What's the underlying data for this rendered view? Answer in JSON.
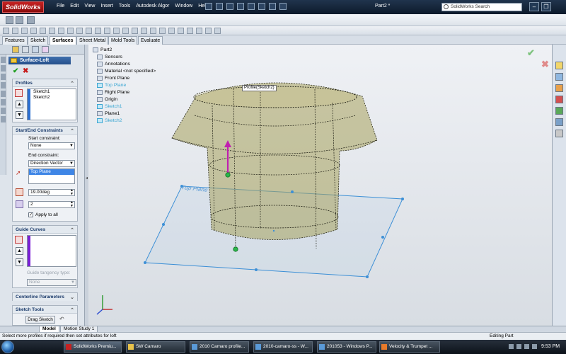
{
  "app": {
    "name": "SolidWorks",
    "document_title": "Part2 *"
  },
  "menu": [
    "File",
    "Edit",
    "View",
    "Insert",
    "Tools",
    "Autodesk Algor",
    "Window",
    "Help"
  ],
  "search": {
    "placeholder": "SolidWorks Search"
  },
  "command_tabs": [
    "Features",
    "Sketch",
    "Surfaces",
    "Sheet Metal",
    "Mold Tools",
    "Evaluate"
  ],
  "property_manager": {
    "title": "Surface-Loft",
    "profiles": {
      "title": "Profiles",
      "items": [
        "Sketch1",
        "Sketch2"
      ]
    },
    "start_end": {
      "title": "Start/End Constraints",
      "start_label": "Start constraint:",
      "start_value": "None",
      "end_label": "End constraint:",
      "end_value": "Direction Vector",
      "direction_entity": "Top Plane",
      "angle": "19.00deg",
      "tangent_length": "2",
      "apply_to_all": "Apply to all"
    },
    "guide_curves": {
      "title": "Guide Curves",
      "tangency_label": "Guide tangency type:",
      "tangency_value": "None"
    },
    "centerline": {
      "title": "Centerline Parameters"
    },
    "sketch_tools": {
      "title": "Sketch Tools",
      "drag_button": "Drag Sketch"
    }
  },
  "feature_tree": {
    "root": "Part2",
    "items": [
      {
        "label": "Sensors",
        "highlight": false
      },
      {
        "label": "Annotations",
        "highlight": false
      },
      {
        "label": "Material <not specified>",
        "highlight": false
      },
      {
        "label": "Front Plane",
        "highlight": false
      },
      {
        "label": "Top Plane",
        "highlight": true
      },
      {
        "label": "Right Plane",
        "highlight": false
      },
      {
        "label": "Origin",
        "highlight": false
      },
      {
        "label": "Sketch1",
        "highlight": true
      },
      {
        "label": "Plane1",
        "highlight": false
      },
      {
        "label": "Sketch2",
        "highlight": true
      }
    ]
  },
  "viewport": {
    "tooltip": "Profile(Sketch2)",
    "plane_label": "Top Plane"
  },
  "bottom_tabs": [
    "Model",
    "Motion Study 1"
  ],
  "status": {
    "message": "Select more profiles if required then set attributes for loft",
    "mode": "Editing Part"
  },
  "taskbar": {
    "buttons": [
      "SolidWorks Premiu...",
      "SW Camaro",
      "2010 Camaro profile...",
      "2010-camaro-ss - W...",
      "201053 - Windows P...",
      "Velocity & Trumpet ..."
    ],
    "clock": "9:53 PM"
  },
  "colors": {
    "accent": "#2d6fd1",
    "surface": "#b7b38a",
    "plane": "#3c8fd6",
    "guide": "#7a1fd6"
  }
}
